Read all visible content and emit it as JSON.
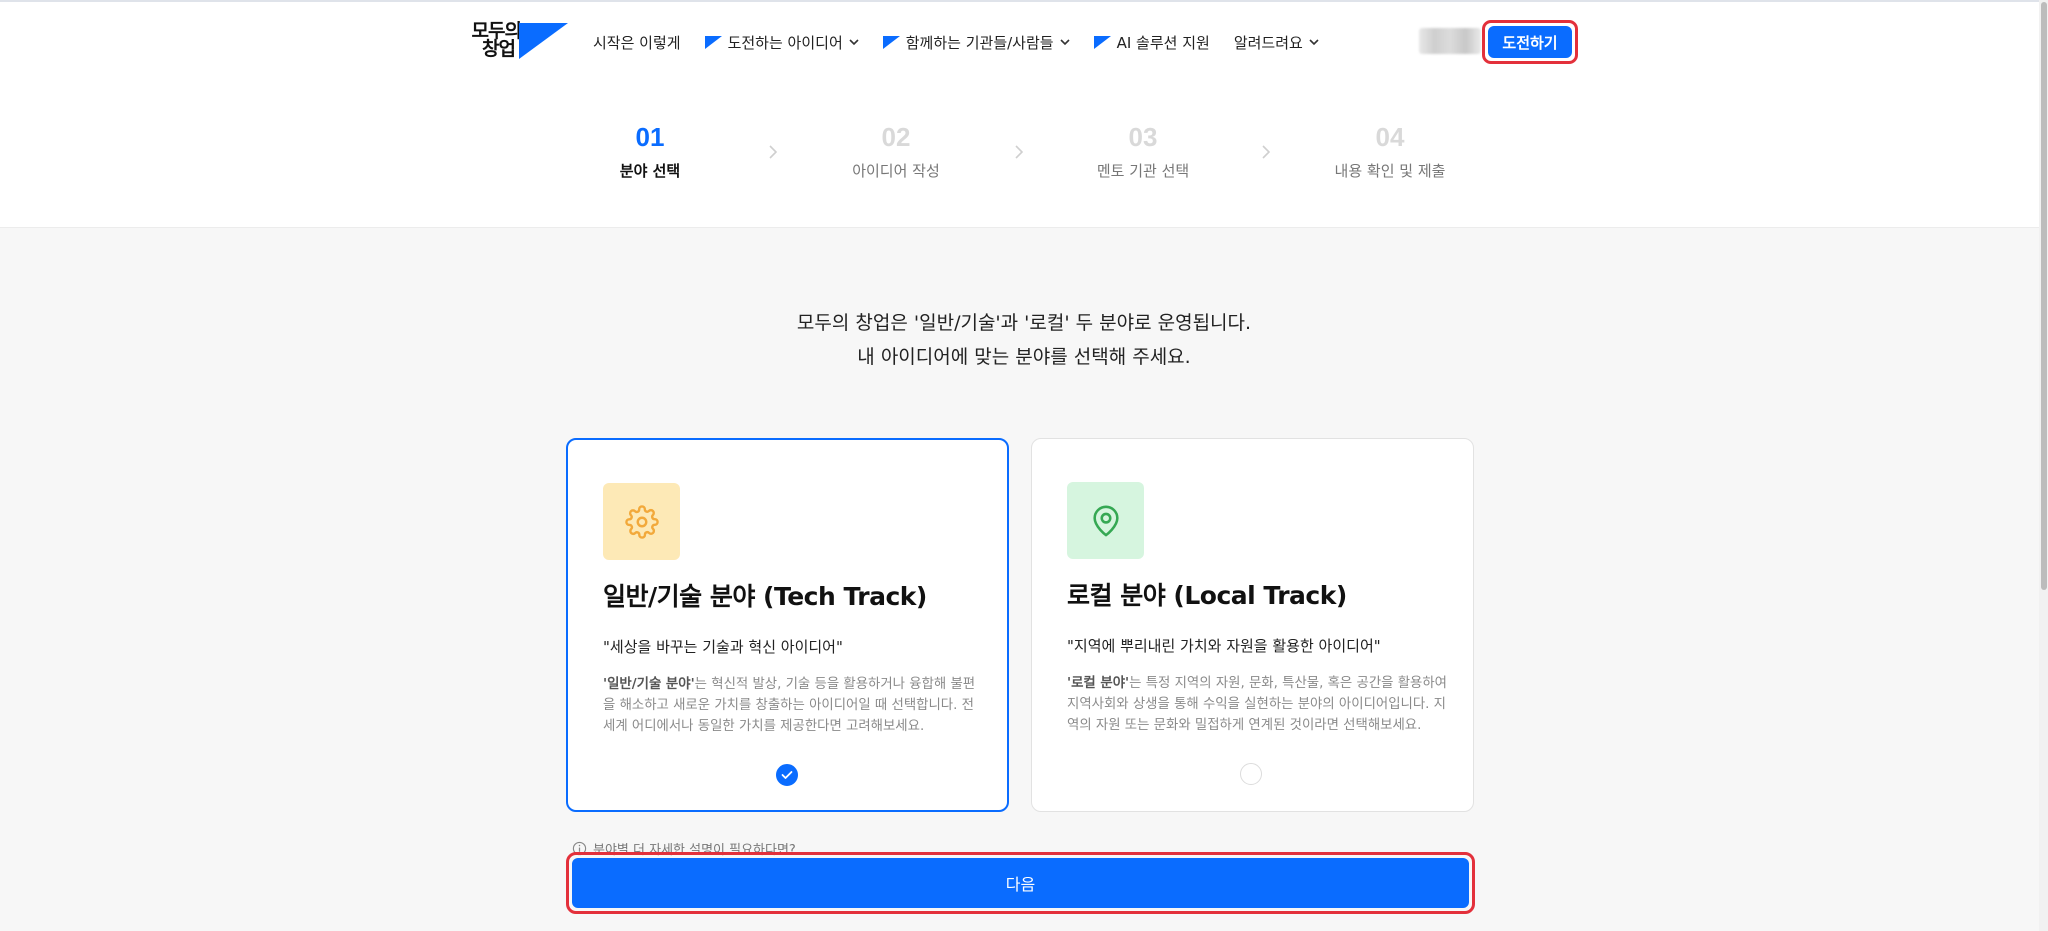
{
  "brand": {
    "logo_text_line1": "모두의",
    "logo_text_line2": "창업",
    "accent": "#0A6CFF"
  },
  "nav": {
    "items": [
      {
        "label": "시작은 이렇게",
        "flag": false,
        "dropdown": false
      },
      {
        "label": "도전하는 아이디어",
        "flag": true,
        "dropdown": true
      },
      {
        "label": "함께하는 기관들/사람들",
        "flag": true,
        "dropdown": true
      },
      {
        "label": "AI 솔루션 지원",
        "flag": true,
        "dropdown": false
      },
      {
        "label": "알려드려요",
        "flag": false,
        "dropdown": true
      }
    ],
    "cta_label": "도전하기"
  },
  "steps": [
    {
      "number": "01",
      "label": "분야 선택",
      "active": true
    },
    {
      "number": "02",
      "label": "아이디어 작성",
      "active": false
    },
    {
      "number": "03",
      "label": "멘토 기관 선택",
      "active": false
    },
    {
      "number": "04",
      "label": "내용 확인 및 제출",
      "active": false
    }
  ],
  "intro": {
    "line1": "모두의 창업은 '일반/기술'과 '로컬' 두 분야로 운영됩니다.",
    "line2": "내 아이디어에 맞는 분야를 선택해 주세요."
  },
  "tracks": [
    {
      "icon": "gear-icon",
      "title": "일반/기술 분야 (Tech Track)",
      "quote": "\"세상을 바꾸는 기술과 혁신 아이디어\"",
      "desc_bold": "'일반/기술 분야'",
      "desc_rest": "는 혁신적 발상, 기술 등을 활용하거나 융합해 불편을 해소하고 새로운 가치를 창출하는 아이디어일 때 선택합니다. 전세계 어디에서나 동일한 가치를 제공한다면 고려해보세요.",
      "selected": true,
      "icon_bg": "#FDE9B6",
      "icon_color": "#F2A93B"
    },
    {
      "icon": "map-pin-icon",
      "title": "로컬 분야 (Local Track)",
      "quote": "\"지역에 뿌리내린 가치와 자원을 활용한 아이디어\"",
      "desc_bold": "'로컬 분야'",
      "desc_rest": "는 특정 지역의 자원, 문화, 특산물, 혹은 공간을 활용하여 지역사회와 상생을 통해 수익을 실현하는 분야의 아이디어입니다. 지역의 자원 또는 문화와 밀접하게 연계된 것이라면 선택해보세요.",
      "selected": false,
      "icon_bg": "#D6F5DF",
      "icon_color": "#35A853"
    }
  ],
  "help_text": "분야별 더 자세한 설명이 필요하다면?",
  "next_label": "다음"
}
